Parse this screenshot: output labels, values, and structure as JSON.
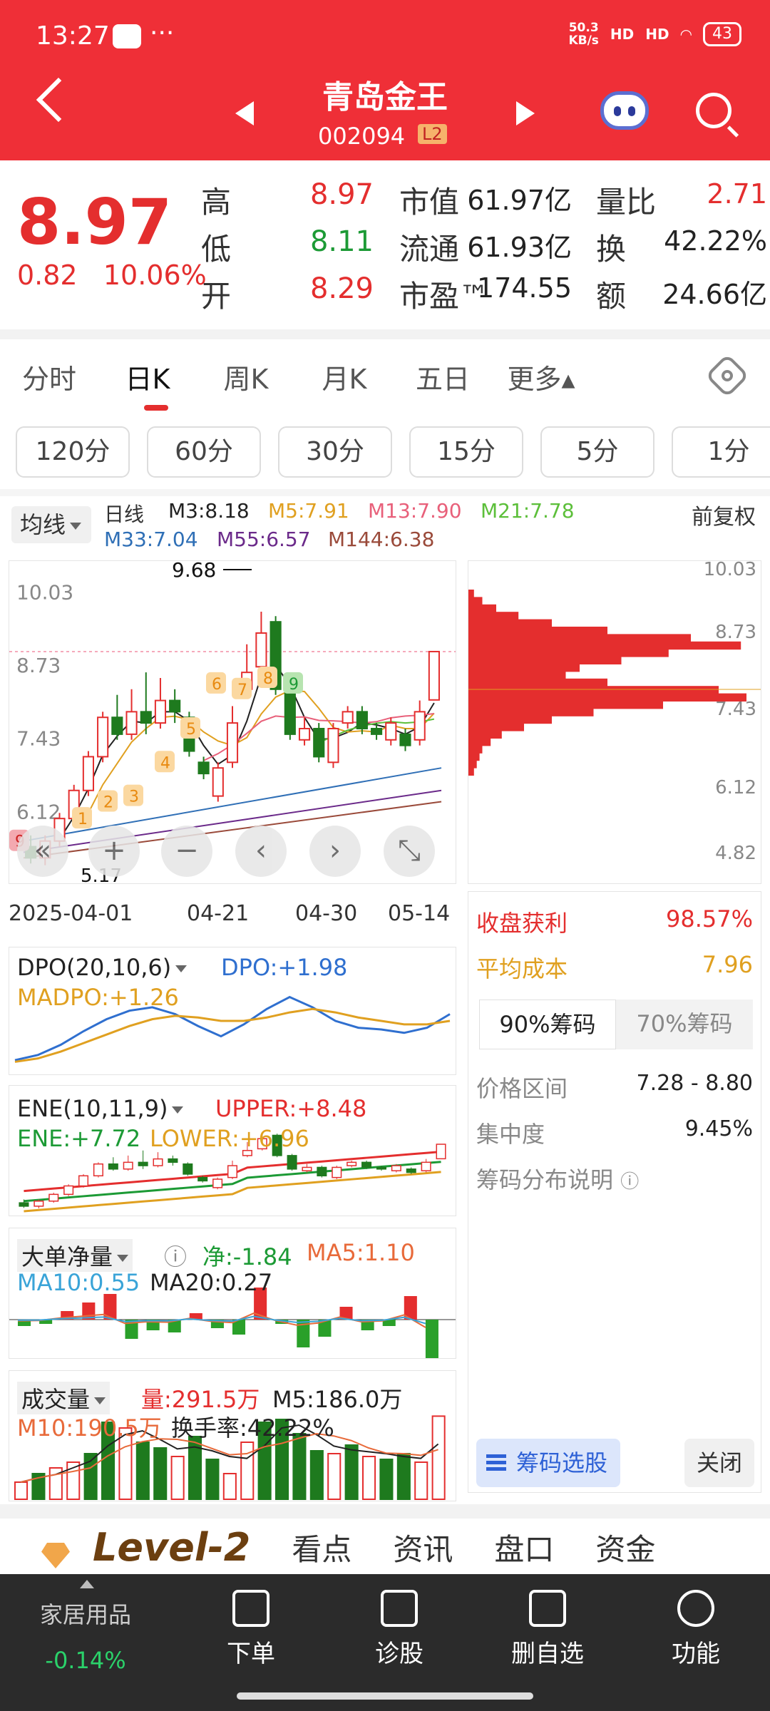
{
  "status_bar": {
    "time": "13:27",
    "dots": "···",
    "net_speed": "50.3",
    "net_unit": "KB/s",
    "signal1": "HD",
    "signal2": "HD",
    "battery": "43"
  },
  "header": {
    "name": "青岛金王",
    "code": "002094",
    "level_badge": "L2"
  },
  "quote": {
    "price": "8.97",
    "change": "0.82",
    "change_pct": "10.06%",
    "rows": [
      {
        "l1": "高",
        "v1": "8.97",
        "c1": "red",
        "l2": "市值",
        "v2": "61.97亿",
        "l3": "量比",
        "v3": "2.71",
        "c3": "red"
      },
      {
        "l1": "低",
        "v1": "8.11",
        "c1": "green",
        "l2": "流通",
        "v2": "61.93亿",
        "l3": "换",
        "v3": "42.22%",
        "c3": "dark"
      },
      {
        "l1": "开",
        "v1": "8.29",
        "c1": "red",
        "l2": "市盈™",
        "v2": "174.55",
        "l3": "额",
        "v3": "24.66亿",
        "c3": "dark"
      }
    ]
  },
  "tabs": [
    "分时",
    "日K",
    "周K",
    "月K",
    "五日",
    "更多▴"
  ],
  "periods": [
    "120分",
    "60分",
    "30分",
    "15分",
    "5分",
    "1分"
  ],
  "ma_bar": {
    "selector": "均线",
    "period": "日线",
    "adjust": "前复权",
    "items": [
      {
        "label": "M3:8.18",
        "color": "#222222"
      },
      {
        "label": "M5:7.91",
        "color": "#e0a020"
      },
      {
        "label": "M13:7.90",
        "color": "#e8607a"
      },
      {
        "label": "M21:7.78",
        "color": "#5cbf3a"
      },
      {
        "label": "M33:7.04",
        "color": "#2f6fb6"
      },
      {
        "label": "M55:6.57",
        "color": "#6b2a8a"
      },
      {
        "label": "M144:6.38",
        "color": "#9a4a3a"
      }
    ]
  },
  "kchart": {
    "y_ticks": [
      "10.03",
      "8.73",
      "7.43",
      "6.12"
    ],
    "high_label": "9.68",
    "low_label": "5.17",
    "x_ticks": [
      "2025-04-01",
      "04-21",
      "04-30",
      "05-14"
    ],
    "badges": [
      "9",
      "1",
      "2",
      "3",
      "4",
      "5",
      "6",
      "7",
      "8",
      "9"
    ],
    "ctrl": [
      "«",
      "+",
      "−",
      "‹",
      "›",
      "⤡"
    ],
    "candles": [
      {
        "o": 5.5,
        "c": 5.3,
        "h": 5.7,
        "l": 5.2
      },
      {
        "o": 5.3,
        "c": 5.6,
        "h": 5.7,
        "l": 5.17
      },
      {
        "o": 5.6,
        "c": 6.0,
        "h": 6.1,
        "l": 5.5
      },
      {
        "o": 6.0,
        "c": 6.5,
        "h": 6.6,
        "l": 5.9
      },
      {
        "o": 6.5,
        "c": 7.1,
        "h": 7.2,
        "l": 6.4
      },
      {
        "o": 7.1,
        "c": 7.8,
        "h": 7.9,
        "l": 7.0
      },
      {
        "o": 7.8,
        "c": 7.5,
        "h": 8.2,
        "l": 7.4
      },
      {
        "o": 7.5,
        "c": 7.9,
        "h": 8.3,
        "l": 7.4
      },
      {
        "o": 7.9,
        "c": 7.7,
        "h": 8.6,
        "l": 7.5
      },
      {
        "o": 7.7,
        "c": 8.1,
        "h": 8.5,
        "l": 7.6
      },
      {
        "o": 8.1,
        "c": 7.9,
        "h": 8.3,
        "l": 7.7
      },
      {
        "o": 7.8,
        "c": 7.2,
        "h": 7.9,
        "l": 7.1
      },
      {
        "o": 7.0,
        "c": 6.8,
        "h": 7.1,
        "l": 6.7
      },
      {
        "o": 6.4,
        "c": 6.9,
        "h": 7.0,
        "l": 6.3
      },
      {
        "o": 7.0,
        "c": 7.7,
        "h": 8.0,
        "l": 6.9
      },
      {
        "o": 8.3,
        "c": 8.6,
        "h": 9.1,
        "l": 8.2
      },
      {
        "o": 8.7,
        "c": 9.3,
        "h": 9.68,
        "l": 8.6
      },
      {
        "o": 9.5,
        "c": 8.3,
        "h": 9.6,
        "l": 8.2
      },
      {
        "o": 8.3,
        "c": 7.5,
        "h": 8.4,
        "l": 7.4
      },
      {
        "o": 7.4,
        "c": 7.6,
        "h": 7.8,
        "l": 7.3
      },
      {
        "o": 7.6,
        "c": 7.1,
        "h": 7.7,
        "l": 7.0
      },
      {
        "o": 7.0,
        "c": 7.6,
        "h": 7.7,
        "l": 6.9
      },
      {
        "o": 7.7,
        "c": 7.9,
        "h": 8.0,
        "l": 7.6
      },
      {
        "o": 7.9,
        "c": 7.6,
        "h": 8.0,
        "l": 7.5
      },
      {
        "o": 7.6,
        "c": 7.5,
        "h": 7.7,
        "l": 7.4
      },
      {
        "o": 7.4,
        "c": 7.7,
        "h": 7.8,
        "l": 7.3
      },
      {
        "o": 7.5,
        "c": 7.3,
        "h": 7.6,
        "l": 7.2
      },
      {
        "o": 7.4,
        "c": 7.9,
        "h": 8.1,
        "l": 7.3
      },
      {
        "o": 8.11,
        "c": 8.97,
        "h": 8.97,
        "l": 8.11
      }
    ]
  },
  "chip": {
    "y_ticks": [
      "10.03",
      "8.73",
      "7.43",
      "6.12",
      "4.82"
    ],
    "profit_label": "收盘获利",
    "profit_value": "98.57%",
    "cost_label": "平均成本",
    "cost_value": "7.96",
    "btn90": "90%筹码",
    "btn70": "70%筹码",
    "range_label": "价格区间",
    "range_value": "7.28 - 8.80",
    "conc_label": "集中度",
    "conc_value": "9.45%",
    "explain": "筹码分布说明",
    "select_btn": "筹码选股",
    "close_btn": "关闭",
    "dist": [
      0.02,
      0.05,
      0.1,
      0.18,
      0.3,
      0.5,
      0.8,
      0.98,
      0.72,
      0.55,
      0.4,
      0.35,
      0.5,
      0.9,
      1.0,
      0.7,
      0.45,
      0.3,
      0.2,
      0.12,
      0.08,
      0.05,
      0.04,
      0.03,
      0.02
    ]
  },
  "dpo": {
    "title": "DPO(20,10,6)",
    "dpo": "DPO:+1.98",
    "madpo": "MADPO:+1.26",
    "dpo_line": [
      -1.5,
      -1.2,
      -0.6,
      0.2,
      0.9,
      1.4,
      1.6,
      1.2,
      0.5,
      -0.1,
      0.6,
      1.5,
      2.2,
      1.6,
      0.8,
      0.4,
      0.3,
      0.1,
      0.4,
      1.2
    ],
    "madpo_line": [
      -1.6,
      -1.4,
      -1.0,
      -0.5,
      0.0,
      0.5,
      0.9,
      1.1,
      1.0,
      0.8,
      0.8,
      1.0,
      1.3,
      1.5,
      1.3,
      1.0,
      0.8,
      0.6,
      0.6,
      0.8
    ]
  },
  "ene": {
    "title": "ENE(10,11,9)",
    "upper": "UPPER:+8.48",
    "ene": "ENE:+7.72",
    "lower": "LOWER:+6.96"
  },
  "big_order": {
    "title": "大单净量",
    "net": "净:-1.84",
    "ma5": "MA5:1.10",
    "ma10": "MA10:0.55",
    "ma20": "MA20:0.27",
    "bars": [
      -0.3,
      -0.2,
      0.4,
      0.8,
      1.2,
      -0.9,
      -0.5,
      -0.6,
      0.3,
      -0.4,
      -0.7,
      1.5,
      -0.2,
      -1.3,
      -0.8,
      0.6,
      -0.5,
      -0.3,
      1.1,
      -1.84
    ]
  },
  "volume": {
    "title": "成交量",
    "vol": "量:291.5万",
    "m5": "M5:186.0万",
    "m10": "M10:190.5万",
    "turnover": "换手率:42.22%",
    "bars": [
      {
        "v": 60,
        "up": true
      },
      {
        "v": 90,
        "up": false
      },
      {
        "v": 110,
        "up": true
      },
      {
        "v": 130,
        "up": true
      },
      {
        "v": 160,
        "up": false
      },
      {
        "v": 270,
        "up": false
      },
      {
        "v": 250,
        "up": true
      },
      {
        "v": 200,
        "up": false
      },
      {
        "v": 180,
        "up": false
      },
      {
        "v": 150,
        "up": true
      },
      {
        "v": 220,
        "up": false
      },
      {
        "v": 140,
        "up": false
      },
      {
        "v": 90,
        "up": true
      },
      {
        "v": 200,
        "up": true
      },
      {
        "v": 270,
        "up": false
      },
      {
        "v": 280,
        "up": false
      },
      {
        "v": 230,
        "up": false
      },
      {
        "v": 170,
        "up": false
      },
      {
        "v": 160,
        "up": true
      },
      {
        "v": 190,
        "up": false
      },
      {
        "v": 150,
        "up": true
      },
      {
        "v": 140,
        "up": false
      },
      {
        "v": 160,
        "up": false
      },
      {
        "v": 130,
        "up": true
      },
      {
        "v": 291.5,
        "up": true
      }
    ]
  },
  "bottom_tabs": {
    "level2": "Level-2",
    "items": [
      "看点",
      "资讯",
      "盘口",
      "资金"
    ]
  },
  "nav": {
    "sector": "家居用品",
    "sector_chg": "-0.14%",
    "items": [
      "下单",
      "诊股",
      "删自选",
      "功能"
    ]
  }
}
